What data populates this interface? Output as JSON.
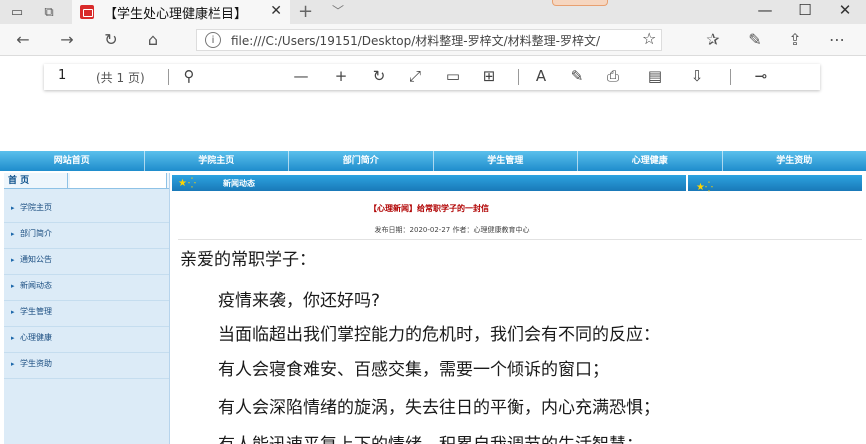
{
  "browser": {
    "tab_title": "【学生处心理健康栏目】",
    "tab_close": "✕",
    "new_tab": "+",
    "tabs_dropdown": "﹀",
    "window_controls": {
      "minimize": "—",
      "maximize": "☐",
      "close": "✕"
    },
    "url": "file:///C:/Users/19151/Desktop/材料整理-罗梓文/材料整理-罗梓文/",
    "info_glyph": "i"
  },
  "pdf_toolbar": {
    "page_number": "1",
    "page_count_label": "(共 1 页)"
  },
  "site_nav": {
    "items": [
      "网站首页",
      "学院主页",
      "部门简介",
      "学生管理",
      "心理健康",
      "学生资助"
    ]
  },
  "sidebar": {
    "header_label": "首 页",
    "items": [
      "学院主页",
      "部门简介",
      "通知公告",
      "新闻动态",
      "学生管理",
      "心理健康",
      "学生资助"
    ]
  },
  "news_section": {
    "header_label": "新闻动态",
    "stars": "★⁛"
  },
  "article": {
    "title": "【心理新闻】给常职学子的一封信",
    "meta": "发布日期：2020-02-27   作者：心理健康教育中心",
    "salutation": "亲爱的常职学子：",
    "paragraphs": [
      "疫情来袭，你还好吗?",
      "当面临超出我们掌控能力的危机时，我们会有不同的反应：",
      "有人会寝食难安、百感交集，需要一个倾诉的窗口；",
      "有人会深陷情绪的旋涡，失去往日的平衡，内心充满恐惧；",
      "有人能迅速平复上下的情绪，积累自我调节的生活智慧；"
    ]
  }
}
